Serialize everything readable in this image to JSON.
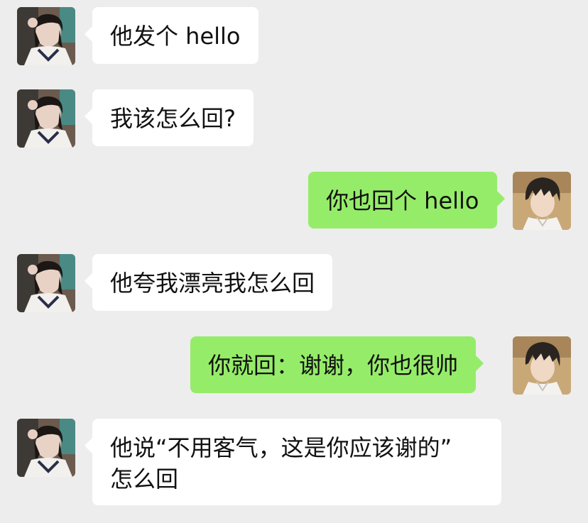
{
  "messages": [
    {
      "side": "left",
      "avatar": "girl-avatar",
      "lines": [
        "他发个 hello"
      ]
    },
    {
      "side": "left",
      "avatar": "girl-avatar",
      "lines": [
        "我该怎么回?"
      ]
    },
    {
      "side": "right",
      "avatar": "boy-avatar",
      "lines": [
        "你也回个 hello"
      ]
    },
    {
      "side": "left",
      "avatar": "girl-avatar",
      "lines": [
        "他夸我漂亮我怎么回"
      ]
    },
    {
      "side": "right",
      "avatar": "boy-avatar",
      "lines": [
        "你就回：谢谢，你也很帅"
      ]
    },
    {
      "side": "left",
      "avatar": "girl-avatar",
      "lines": [
        "他说“不用客气，这是你应该谢的”",
        "怎么回"
      ]
    }
  ],
  "colors": {
    "background": "#ededed",
    "incoming_bubble": "#ffffff",
    "outgoing_bubble": "#95ec69",
    "text": "#111111"
  }
}
